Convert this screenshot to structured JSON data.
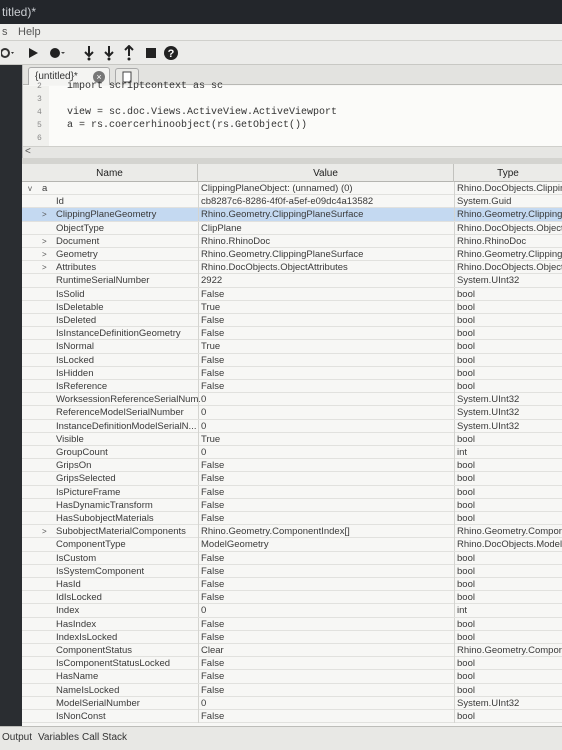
{
  "window": {
    "title": "titled)*"
  },
  "menu": {
    "help": "Help",
    "left_fragment": "s"
  },
  "toolbar": {
    "buttons": [
      "run-menu-icon",
      "run-icon",
      "record-icon",
      "step-into-icon",
      "step-over-icon",
      "step-out-icon",
      "stop-icon",
      "help-icon"
    ]
  },
  "editor": {
    "tab_label": "{untitled}*",
    "tab_close": "×",
    "lines": [
      {
        "num": "2",
        "text": "import scriptcontext as sc"
      },
      {
        "num": "3",
        "text": ""
      },
      {
        "num": "4",
        "text": "view = sc.doc.Views.ActiveView.ActiveViewport"
      },
      {
        "num": "5",
        "text": "a = rs.coercerhinoobject(rs.GetObject())"
      },
      {
        "num": "6",
        "text": ""
      }
    ],
    "scroll_arrow": "<"
  },
  "variables": {
    "headers": {
      "name": "Name",
      "value": "Value",
      "type": "Type"
    },
    "rows": [
      {
        "name": "a",
        "value": "ClippingPlaneObject: (unnamed) (0)",
        "type": "Rhino.DocObjects.ClippingPlaneObject",
        "expand": "v",
        "indent": 0
      },
      {
        "name": "Id",
        "value": "cb8287c6-8286-4f0f-a5ef-e09dc4a13582",
        "type": "System.Guid",
        "expand": "",
        "indent": 1
      },
      {
        "name": "ClippingPlaneGeometry",
        "value": "Rhino.Geometry.ClippingPlaneSurface",
        "type": "Rhino.Geometry.ClippingPlaneSurface",
        "expand": ">",
        "indent": 1,
        "selected": true
      },
      {
        "name": "ObjectType",
        "value": "ClipPlane",
        "type": "Rhino.DocObjects.ObjectType",
        "expand": "",
        "indent": 1
      },
      {
        "name": "Document",
        "value": "Rhino.RhinoDoc",
        "type": "Rhino.RhinoDoc",
        "expand": ">",
        "indent": 1
      },
      {
        "name": "Geometry",
        "value": "Rhino.Geometry.ClippingPlaneSurface",
        "type": "Rhino.Geometry.ClippingPlaneSurface",
        "expand": ">",
        "indent": 1
      },
      {
        "name": "Attributes",
        "value": "Rhino.DocObjects.ObjectAttributes",
        "type": "Rhino.DocObjects.ObjectAttributes",
        "expand": ">",
        "indent": 1
      },
      {
        "name": "RuntimeSerialNumber",
        "value": "2922",
        "type": "System.UInt32",
        "expand": "",
        "indent": 1
      },
      {
        "name": "IsSolid",
        "value": "False",
        "type": "bool",
        "expand": "",
        "indent": 1
      },
      {
        "name": "IsDeletable",
        "value": "True",
        "type": "bool",
        "expand": "",
        "indent": 1
      },
      {
        "name": "IsDeleted",
        "value": "False",
        "type": "bool",
        "expand": "",
        "indent": 1
      },
      {
        "name": "IsInstanceDefinitionGeometry",
        "value": "False",
        "type": "bool",
        "expand": "",
        "indent": 1
      },
      {
        "name": "IsNormal",
        "value": "True",
        "type": "bool",
        "expand": "",
        "indent": 1
      },
      {
        "name": "IsLocked",
        "value": "False",
        "type": "bool",
        "expand": "",
        "indent": 1
      },
      {
        "name": "IsHidden",
        "value": "False",
        "type": "bool",
        "expand": "",
        "indent": 1
      },
      {
        "name": "IsReference",
        "value": "False",
        "type": "bool",
        "expand": "",
        "indent": 1
      },
      {
        "name": "WorksessionReferenceSerialNum...",
        "value": "0",
        "type": "System.UInt32",
        "expand": "",
        "indent": 1
      },
      {
        "name": "ReferenceModelSerialNumber",
        "value": "0",
        "type": "System.UInt32",
        "expand": "",
        "indent": 1
      },
      {
        "name": "InstanceDefinitionModelSerialN...",
        "value": "0",
        "type": "System.UInt32",
        "expand": "",
        "indent": 1
      },
      {
        "name": "Visible",
        "value": "True",
        "type": "bool",
        "expand": "",
        "indent": 1
      },
      {
        "name": "GroupCount",
        "value": "0",
        "type": "int",
        "expand": "",
        "indent": 1
      },
      {
        "name": "GripsOn",
        "value": "False",
        "type": "bool",
        "expand": "",
        "indent": 1
      },
      {
        "name": "GripsSelected",
        "value": "False",
        "type": "bool",
        "expand": "",
        "indent": 1
      },
      {
        "name": "IsPictureFrame",
        "value": "False",
        "type": "bool",
        "expand": "",
        "indent": 1
      },
      {
        "name": "HasDynamicTransform",
        "value": "False",
        "type": "bool",
        "expand": "",
        "indent": 1
      },
      {
        "name": "HasSubobjectMaterials",
        "value": "False",
        "type": "bool",
        "expand": "",
        "indent": 1
      },
      {
        "name": "SubobjectMaterialComponents",
        "value": "Rhino.Geometry.ComponentIndex[]",
        "type": "Rhino.Geometry.ComponentIndex[]",
        "expand": ">",
        "indent": 1
      },
      {
        "name": "ComponentType",
        "value": "ModelGeometry",
        "type": "Rhino.DocObjects.ModelComponentType",
        "expand": "",
        "indent": 1
      },
      {
        "name": "IsCustom",
        "value": "False",
        "type": "bool",
        "expand": "",
        "indent": 1
      },
      {
        "name": "IsSystemComponent",
        "value": "False",
        "type": "bool",
        "expand": "",
        "indent": 1
      },
      {
        "name": "HasId",
        "value": "False",
        "type": "bool",
        "expand": "",
        "indent": 1
      },
      {
        "name": "IdIsLocked",
        "value": "False",
        "type": "bool",
        "expand": "",
        "indent": 1
      },
      {
        "name": "Index",
        "value": "0",
        "type": "int",
        "expand": "",
        "indent": 1
      },
      {
        "name": "HasIndex",
        "value": "False",
        "type": "bool",
        "expand": "",
        "indent": 1
      },
      {
        "name": "IndexIsLocked",
        "value": "False",
        "type": "bool",
        "expand": "",
        "indent": 1
      },
      {
        "name": "ComponentStatus",
        "value": "Clear",
        "type": "Rhino.Geometry.ComponentStatus",
        "expand": "",
        "indent": 1
      },
      {
        "name": "IsComponentStatusLocked",
        "value": "False",
        "type": "bool",
        "expand": "",
        "indent": 1
      },
      {
        "name": "HasName",
        "value": "False",
        "type": "bool",
        "expand": "",
        "indent": 1
      },
      {
        "name": "NameIsLocked",
        "value": "False",
        "type": "bool",
        "expand": "",
        "indent": 1
      },
      {
        "name": "ModelSerialNumber",
        "value": "0",
        "type": "System.UInt32",
        "expand": "",
        "indent": 1
      },
      {
        "name": "IsNonConst",
        "value": "False",
        "type": "bool",
        "expand": "",
        "indent": 1
      }
    ]
  },
  "bottom_tabs": [
    "Output",
    "Variables",
    "Call Stack"
  ]
}
